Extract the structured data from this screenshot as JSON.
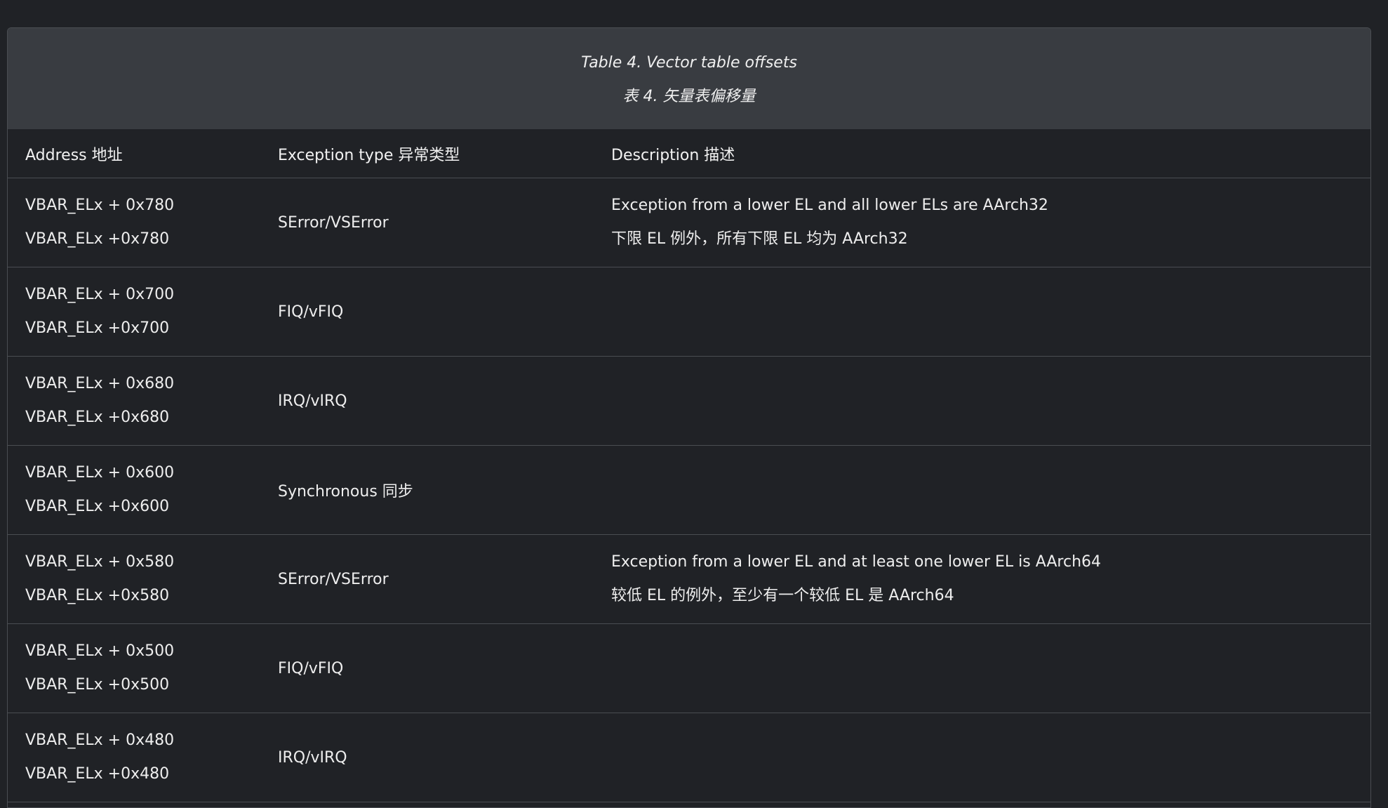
{
  "table": {
    "caption_en": "Table 4. Vector table offsets",
    "caption_zh": "表 4. 矢量表偏移量",
    "headers": {
      "address": "Address 地址",
      "type": "Exception type 异常类型",
      "description": "Description 描述"
    },
    "rows": [
      {
        "addr1": "VBAR_ELx + 0x780",
        "addr2": "VBAR_ELx +0x780",
        "type": "SError/VSError",
        "desc1": "Exception from a lower EL and all lower ELs are AArch32",
        "desc2": "下限 EL 例外，所有下限 EL 均为 AArch32"
      },
      {
        "addr1": "VBAR_ELx + 0x700",
        "addr2": "VBAR_ELx +0x700",
        "type": "FIQ/vFIQ",
        "desc1": "",
        "desc2": ""
      },
      {
        "addr1": "VBAR_ELx + 0x680",
        "addr2": "VBAR_ELx +0x680",
        "type": "IRQ/vIRQ",
        "desc1": "",
        "desc2": ""
      },
      {
        "addr1": "VBAR_ELx + 0x600",
        "addr2": "VBAR_ELx +0x600",
        "type": "Synchronous 同步",
        "desc1": "",
        "desc2": ""
      },
      {
        "addr1": "VBAR_ELx + 0x580",
        "addr2": "VBAR_ELx +0x580",
        "type": "SError/VSError",
        "desc1": "Exception from a lower EL and at least one lower EL is AArch64",
        "desc2": "较低 EL 的例外，至少有一个较低 EL 是 AArch64"
      },
      {
        "addr1": "VBAR_ELx + 0x500",
        "addr2": "VBAR_ELx +0x500",
        "type": "FIQ/vFIQ",
        "desc1": "",
        "desc2": ""
      },
      {
        "addr1": "VBAR_ELx + 0x480",
        "addr2": "VBAR_ELx +0x480",
        "type": "IRQ/vIRQ",
        "desc1": "",
        "desc2": ""
      }
    ]
  }
}
